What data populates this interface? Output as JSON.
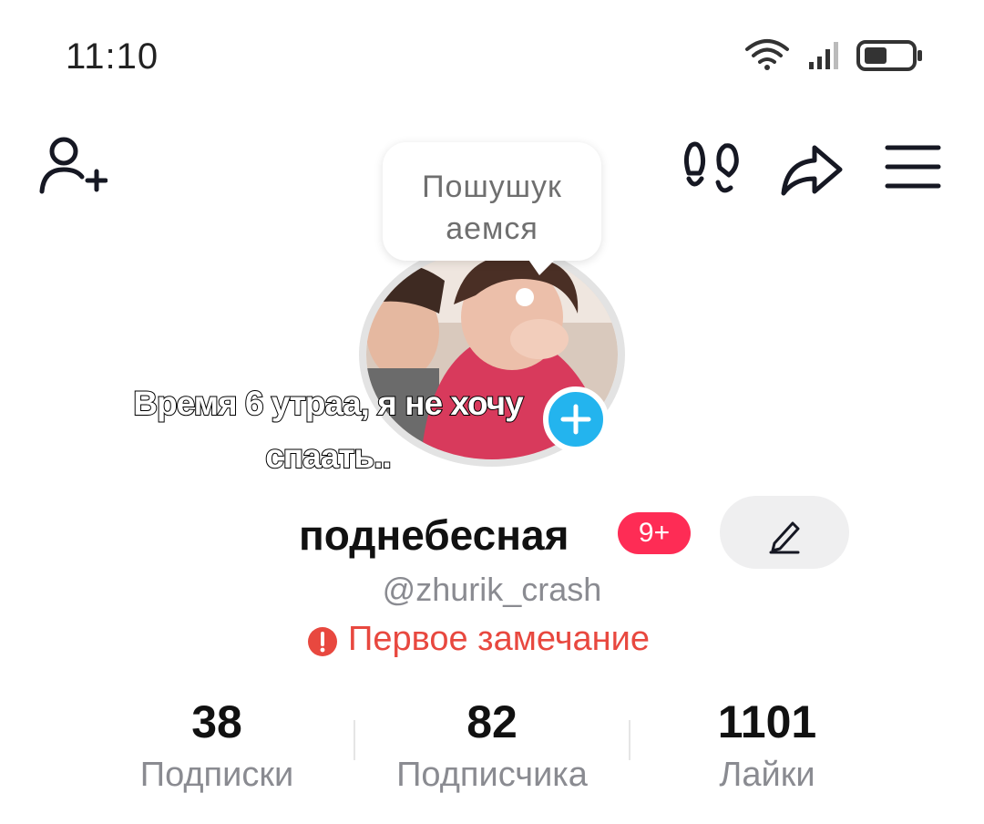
{
  "status_bar": {
    "time": "11:10",
    "icons": [
      "wifi-icon",
      "cellular-signal-icon",
      "battery-icon"
    ]
  },
  "header": {
    "icons": [
      "add-friend-icon",
      "footprints-icon",
      "share-icon",
      "menu-icon"
    ]
  },
  "profile": {
    "status_note": "Пошушук аемся",
    "overlay_caption": "Время 6 утраа, я не хочу спаать..",
    "nickname": "поднебесная",
    "notification_badge": "9+",
    "username": "@zhurik_crash",
    "warning": "Первое замечание"
  },
  "stats": {
    "following": {
      "value": "38",
      "label": "Подписки"
    },
    "followers": {
      "value": "82",
      "label": "Подписчика"
    },
    "likes": {
      "value": "1101",
      "label": "Лайки"
    }
  },
  "colors": {
    "accent_red": "#fe2c55",
    "warning_red": "#e8483f",
    "plus_blue": "#23b4ee",
    "secondary_text": "#8a8b91"
  }
}
